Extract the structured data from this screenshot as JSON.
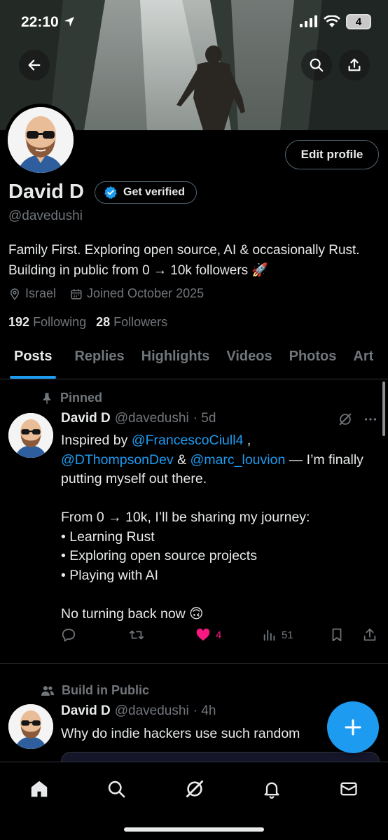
{
  "status_bar": {
    "time": "22:10",
    "battery": "4"
  },
  "profile": {
    "name": "David D",
    "verify_label": "Get verified",
    "handle": "@davedushi",
    "edit_label": "Edit profile",
    "bio": "Family First. Exploring open source, AI & occasionally Rust. Building in public from 0 → 10k followers 🚀",
    "location": "Israel",
    "joined": "Joined October 2025",
    "following_count": "192",
    "following_label": "Following",
    "followers_count": "28",
    "followers_label": "Followers"
  },
  "tabs": [
    {
      "label": "Posts",
      "active": true
    },
    {
      "label": "Replies"
    },
    {
      "label": "Highlights"
    },
    {
      "label": "Videos"
    },
    {
      "label": "Photos"
    },
    {
      "label": "Art"
    }
  ],
  "posts": [
    {
      "context": "Pinned",
      "author": "David D",
      "handle": "@davedushi",
      "time": "· 5d",
      "text_1": "Inspired by ",
      "mention_1": "@FrancescoCiull4",
      "text_2": " ,",
      "mention_2": "@DThompsonDev",
      "text_3": " & ",
      "mention_3": "@marc_louvion",
      "text_4": " — I’m finally putting myself out there.",
      "text_5": "From 0 → 10k, I’ll be sharing my journey:",
      "bullet_1": "• Learning Rust",
      "bullet_2": "• Exploring open source projects",
      "bullet_3": "• Playing with AI",
      "text_6": "No turning back now 🙃",
      "likes": "4",
      "views": "51"
    },
    {
      "context": "Build in Public",
      "author": "David D",
      "handle": "@davedushi",
      "time": "· 4h",
      "text": "Why do indie hackers use such random"
    }
  ],
  "colors": {
    "accent": "#1d9bf0",
    "like": "#f91880",
    "muted": "#71767b",
    "border": "#2f3336"
  }
}
